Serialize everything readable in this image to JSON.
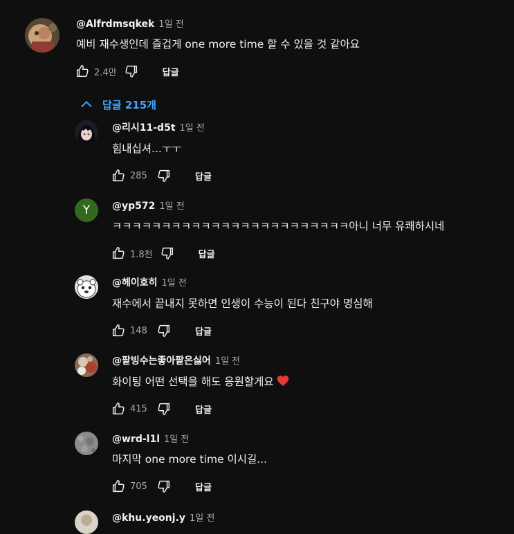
{
  "top_comment": {
    "author": "@Alfrdmsqkek",
    "time": "1일 전",
    "text": "예비 재수생인데 즐겁게 one more time 할 수 있을 것 같아요",
    "likes": "2.4만",
    "reply_label": "답글"
  },
  "replies_toggle": {
    "label": "답글 215개"
  },
  "replies": [
    {
      "author": "@리시11-d5t",
      "time": "1일 전",
      "text": "힘내십셔...ㅜㅜ",
      "likes": "285",
      "reply_label": "답글"
    },
    {
      "author": "@yp572",
      "time": "1일 전",
      "text": "ㅋㅋㅋㅋㅋㅋㅋㅋㅋㅋㅋㅋㅋㅋㅋㅋㅋㅋㅋㅋㅋㅋㅋㅋ아니 너무 유쾌하시네",
      "likes": "1.8천",
      "reply_label": "답글",
      "avatar_letter": "Y"
    },
    {
      "author": "@헤이호히",
      "time": "1일 전",
      "text": "재수에서 끝내지 못하면 인생이 수능이 된다 친구야 명심해",
      "likes": "148",
      "reply_label": "답글"
    },
    {
      "author": "@팥빙수는좋아팥은싫어",
      "time": "1일 전",
      "text": "화이팅 어떤 선택을 해도 응원할게요",
      "likes": "415",
      "reply_label": "답글"
    },
    {
      "author": "@wrd-l1l",
      "time": "1일 전",
      "text": "마지막 one more time 이시길...",
      "likes": "705",
      "reply_label": "답글"
    },
    {
      "author": "@khu.yeonj.y",
      "time": "1일 전"
    }
  ],
  "colors": {
    "background": "#0f0f0f",
    "primary_text": "#f1f1f1",
    "secondary_text": "#aaaaaa",
    "link_blue": "#3ea6ff",
    "y_avatar": "#33691e",
    "heart": "#e53935"
  },
  "icons": {
    "like": "thumb-up-icon",
    "dislike": "thumb-down-icon",
    "collapse": "chevron-up-icon",
    "heart": "heart-emoji-icon"
  }
}
